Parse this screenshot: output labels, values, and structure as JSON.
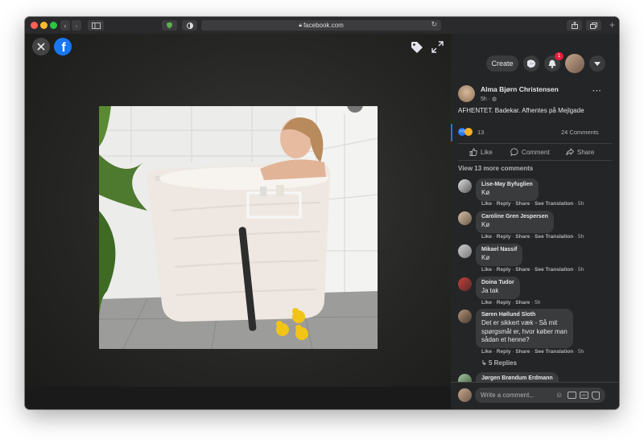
{
  "browser": {
    "url": "facebook.com"
  },
  "viewer": {
    "close_icon": "close-icon",
    "logo_icon": "facebook-logo-icon"
  },
  "header": {
    "create_label": "Create",
    "notification_count": "1"
  },
  "post": {
    "author": "Alma Bjørn Christensen",
    "time": "5h",
    "text": "AFHENTET. Badekar. Afhentes på Mejlgade",
    "reaction_count": "13",
    "comments_count": "24 Comments",
    "like_label": "Like",
    "comment_label": "Comment",
    "share_label": "Share",
    "view_more": "View 13 more comments"
  },
  "comments": [
    {
      "name": "Lise-May Byfuglien",
      "text": "Kø",
      "actions": [
        "Like",
        "Reply",
        "Share",
        "See Translation",
        "5h"
      ]
    },
    {
      "name": "Caroline Gren Jespersen",
      "text": "Kø",
      "actions": [
        "Like",
        "Reply",
        "Share",
        "See Translation",
        "5h"
      ]
    },
    {
      "name": "Mikael Nassif",
      "text": "Kø",
      "actions": [
        "Like",
        "Reply",
        "Share",
        "See Translation",
        "5h"
      ]
    },
    {
      "name": "Doina Tudor",
      "text": "Ja tak",
      "actions": [
        "Like",
        "Reply",
        "Share",
        "5h"
      ]
    },
    {
      "name": "Søren Høllund Sloth",
      "text_lines": [
        "Det er sikkert væk - Så mit",
        "spørgsmål er, hvor køber man",
        "sådan et henne?"
      ],
      "actions": [
        "Like",
        "Reply",
        "Share",
        "See Translation",
        "5h"
      ]
    },
    {
      "name": "Jørgen Brøndum Erdmann"
    }
  ],
  "replies_label": "5 Replies",
  "composer": {
    "placeholder": "Write a comment..."
  }
}
